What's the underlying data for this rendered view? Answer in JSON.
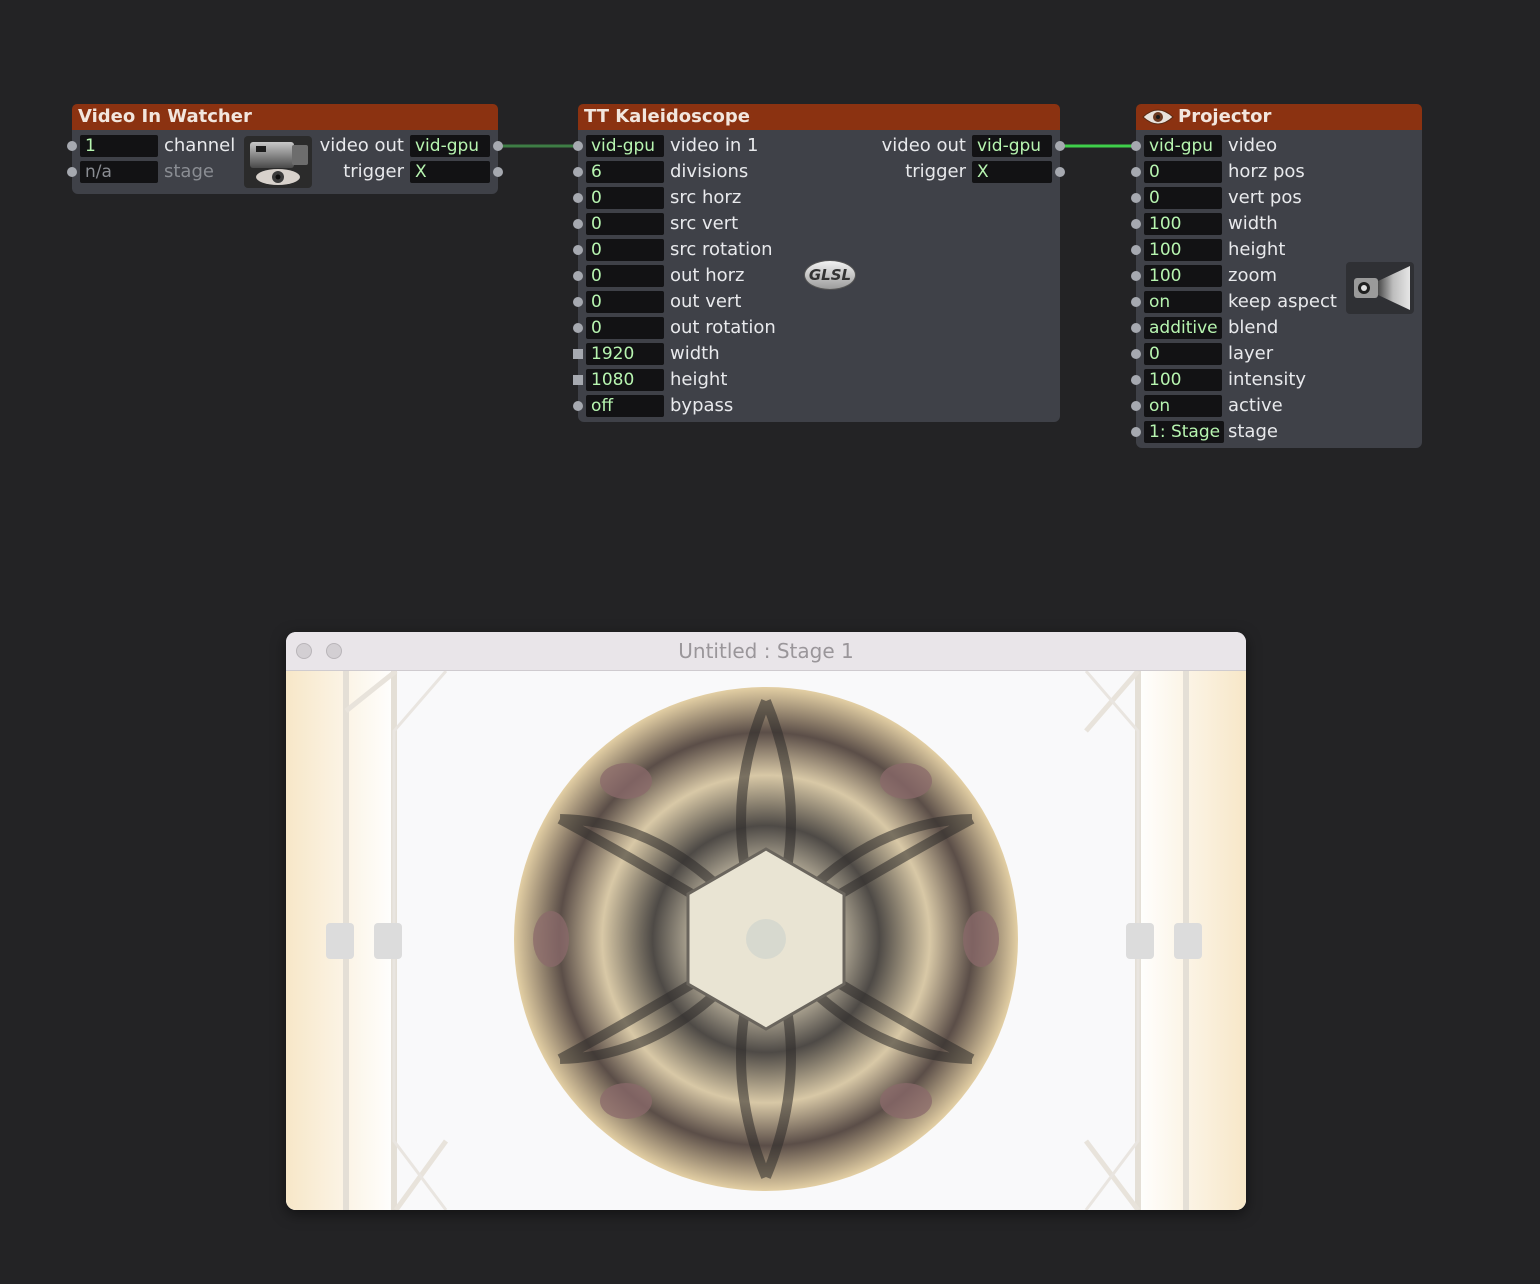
{
  "video_in_watcher": {
    "title": "Video In Watcher",
    "inputs": [
      {
        "value": "1",
        "label": "channel"
      },
      {
        "value": "n/a",
        "label": "stage"
      }
    ],
    "outputs": [
      {
        "label": "video out",
        "value": "vid-gpu"
      },
      {
        "label": "trigger",
        "value": "X"
      }
    ],
    "icon": "camera-eye-icon"
  },
  "kaleidoscope": {
    "title": "TT Kaleidoscope",
    "inputs": [
      {
        "value": "vid-gpu",
        "label": "video in 1"
      },
      {
        "value": "6",
        "label": "divisions"
      },
      {
        "value": "0",
        "label": "src horz"
      },
      {
        "value": "0",
        "label": "src vert"
      },
      {
        "value": "0",
        "label": "src rotation"
      },
      {
        "value": "0",
        "label": "out horz"
      },
      {
        "value": "0",
        "label": "out vert"
      },
      {
        "value": "0",
        "label": "out rotation"
      },
      {
        "value": "1920",
        "label": "width"
      },
      {
        "value": "1080",
        "label": "height"
      },
      {
        "value": "off",
        "label": "bypass"
      }
    ],
    "outputs": [
      {
        "label": "video out",
        "value": "vid-gpu"
      },
      {
        "label": "trigger",
        "value": "X"
      }
    ],
    "badge": "GLSL"
  },
  "projector": {
    "title": "Projector",
    "inputs": [
      {
        "value": "vid-gpu",
        "label": "video"
      },
      {
        "value": "0",
        "label": "horz pos"
      },
      {
        "value": "0",
        "label": "vert pos"
      },
      {
        "value": "100",
        "label": "width"
      },
      {
        "value": "100",
        "label": "height"
      },
      {
        "value": "100",
        "label": "zoom"
      },
      {
        "value": "on",
        "label": "keep aspect"
      },
      {
        "value": "additive",
        "label": "blend"
      },
      {
        "value": "0",
        "label": "layer"
      },
      {
        "value": "100",
        "label": "intensity"
      },
      {
        "value": "on",
        "label": "active"
      },
      {
        "value": "1: Stage",
        "label": "stage"
      }
    ],
    "icon": "projector-icon",
    "title_icon": "eye-icon"
  },
  "stage_window": {
    "title": "Untitled : Stage 1"
  },
  "colors": {
    "title_bar": "#8b3211",
    "actor_body": "#3f4148",
    "value_text": "#b7f5b0",
    "wire": "#3fcf4a"
  }
}
